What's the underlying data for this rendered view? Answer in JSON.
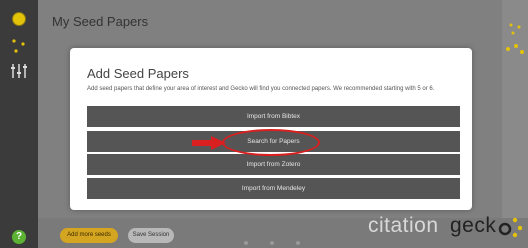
{
  "header": {
    "title": "My Seed Papers"
  },
  "modal": {
    "title": "Add Seed Papers",
    "description": "Add seed papers that define your area of interest and Gecko will find you connected papers. We recommended starting with 5 or 6.",
    "buttons": {
      "bibtex": "Import from Bibtex",
      "search": "Search for Papers",
      "zotero": "Import from Zotero",
      "mendeley": "Import from Mendeley"
    }
  },
  "footer": {
    "add_more_seeds": "Add more seeds",
    "save_session": "Save Session"
  },
  "brand": {
    "citation": "citation",
    "gecko": "geck"
  },
  "sidebar": {
    "help": "?"
  },
  "colors": {
    "accent": "#d4a520",
    "highlight": "#d91f1f",
    "help": "#5cb233",
    "logo": "#e3c20a"
  }
}
